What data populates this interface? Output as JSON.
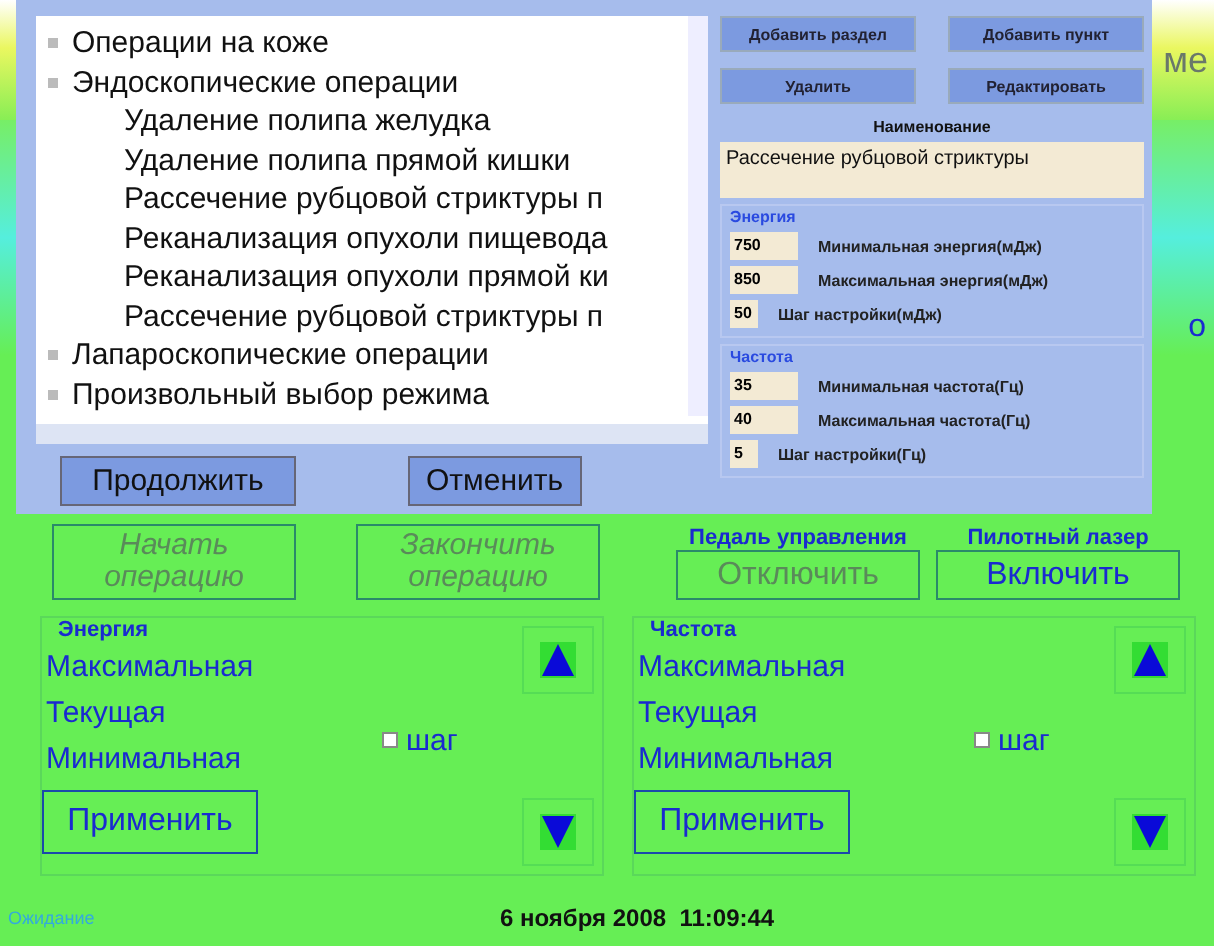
{
  "background": {
    "header_fragment": "ме",
    "side_fragment": "о"
  },
  "dialog": {
    "tree": [
      {
        "label": "Операции на коже"
      },
      {
        "label": "Эндоскопические операции",
        "children": [
          {
            "label": "Удаление полипа желудка"
          },
          {
            "label": "Удаление полипа прямой кишки"
          },
          {
            "label": "Рассечение рубцовой стриктуры п"
          },
          {
            "label": "Реканализация опухоли пищевода"
          },
          {
            "label": "Реканализация опухоли прямой ки"
          },
          {
            "label": "Рассечение рубцовой стриктуры п"
          }
        ]
      },
      {
        "label": "Лапароскопические операции"
      },
      {
        "label": "Произвольный выбор режима"
      }
    ],
    "buttons": [
      "Продолжить",
      "Отменить"
    ],
    "edit_buttons": [
      "Добавить раздел",
      "Добавить пункт",
      "Удалить",
      "Редактировать"
    ],
    "name_label": "Наименование",
    "name_value": "Рассечение рубцовой стриктуры",
    "groups": [
      {
        "title": "Энергия",
        "fields": [
          {
            "value": "750",
            "label": "Минимальная энергия(мДж)"
          },
          {
            "value": "850",
            "label": "Максимальная энергия(мДж)"
          },
          {
            "value": "50",
            "label": "Шаг настройки(мДж)"
          }
        ]
      },
      {
        "title": "Частота",
        "fields": [
          {
            "value": "35",
            "label": "Минимальная частота(Гц)"
          },
          {
            "value": "40",
            "label": "Максимальная частота(Гц)"
          },
          {
            "value": "5",
            "label": "Шаг настройки(Гц)"
          }
        ]
      }
    ]
  },
  "operation_buttons": [
    {
      "label": "Начать операцию",
      "disabled": true
    },
    {
      "label": "Закончить операцию",
      "disabled": true
    }
  ],
  "toggles": [
    {
      "caption": "Педаль управления",
      "button": "Отключить",
      "disabled": true
    },
    {
      "caption": "Пилотный лазер",
      "button": "Включить",
      "disabled": false
    }
  ],
  "panels": [
    {
      "title": "Энергия",
      "max": "Максимальная",
      "current": "Текущая",
      "min": "Минимальная",
      "step": "шаг",
      "step_checked": false,
      "apply": "Применить"
    },
    {
      "title": "Частота",
      "max": "Максимальная",
      "current": "Текущая",
      "min": "Минимальная",
      "step": "шаг",
      "step_checked": false,
      "apply": "Применить"
    }
  ],
  "status_bar": {
    "state": "Ожидание",
    "datetime": "6 ноября 2008  11:09:44"
  }
}
